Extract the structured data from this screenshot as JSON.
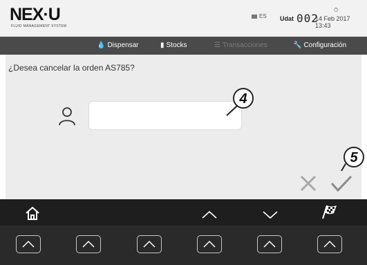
{
  "header": {
    "logo": "NEX·U",
    "logo_subtitle": "FLUID MANAGEMENT SYSTEM",
    "language": "ES",
    "udat_label": "Udat",
    "udat_value": "002",
    "datetime": "14 Feb 2017 13:43"
  },
  "nav": {
    "items": [
      {
        "label": "Dispensar",
        "icon": "drop-icon",
        "enabled": true
      },
      {
        "label": "Stocks",
        "icon": "barrel-icon",
        "enabled": true
      },
      {
        "label": "Transacciones",
        "icon": "list-icon",
        "enabled": false
      },
      {
        "label": "Configuración",
        "icon": "wrench-icon",
        "enabled": true
      }
    ]
  },
  "main": {
    "question": "¿Desea cancelar la orden AS785?",
    "input_value": "",
    "callouts": [
      "4",
      "5"
    ]
  },
  "colors": {
    "nav_bg": "#4a4a4a",
    "content_bg": "#ececec",
    "bottom_bg": "#2a2a2a"
  },
  "bottom_bar": {
    "icons": [
      "home-icon",
      "arrow-up-icon",
      "arrow-down-icon",
      "checkered-flag-icon"
    ],
    "softkeys": 6
  }
}
